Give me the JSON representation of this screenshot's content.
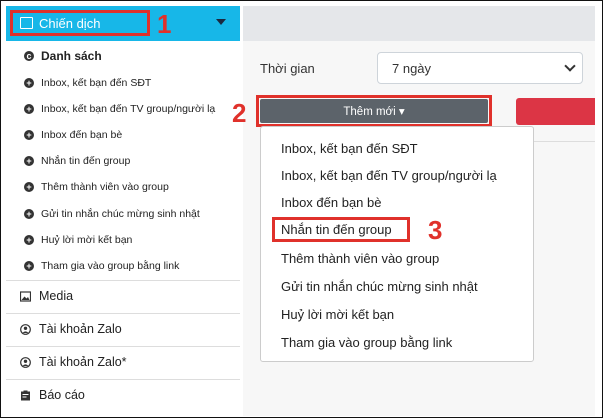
{
  "sidebar": {
    "campaign_label": "Chiến dịch",
    "items": [
      {
        "label": "Danh sách",
        "icon": "list-dot-icon"
      },
      {
        "label": "Inbox, kết bạn đến SĐT",
        "icon": "plus-dot-icon"
      },
      {
        "label": "Inbox, kết bạn đến TV group/người lạ",
        "icon": "plus-dot-icon"
      },
      {
        "label": "Inbox đến bạn bè",
        "icon": "plus-dot-icon"
      },
      {
        "label": "Nhắn tin đến group",
        "icon": "plus-dot-icon"
      },
      {
        "label": "Thêm thành viên vào group",
        "icon": "plus-dot-icon"
      },
      {
        "label": "Gửi tin nhắn chúc mừng sinh nhật",
        "icon": "plus-dot-icon"
      },
      {
        "label": "Huỷ lời mời kết bạn",
        "icon": "plus-dot-icon"
      },
      {
        "label": "Tham gia vào group bằng link",
        "icon": "plus-dot-icon"
      }
    ],
    "main_items": [
      {
        "label": "Media",
        "icon": "image-icon"
      },
      {
        "label": "Tài khoản Zalo",
        "icon": "user-circle-icon"
      },
      {
        "label": "Tài khoản Zalo*",
        "icon": "user-circle-icon"
      },
      {
        "label": "Báo cáo",
        "icon": "report-icon"
      }
    ]
  },
  "annotations": {
    "n1": "1",
    "n2": "2",
    "n3": "3"
  },
  "filter": {
    "label": "Thời gian",
    "value": "7 ngày"
  },
  "add_button": {
    "label": "Thêm mới ▾"
  },
  "dropdown": {
    "items": [
      "Inbox, kết bạn đến SĐT",
      "Inbox, kết bạn đến TV group/người lạ",
      "Inbox đến bạn bè",
      "Nhắn tin đến group",
      "Thêm thành viên vào group",
      "Gửi tin nhắn chúc mừng sinh nhật",
      "Huỷ lời mời kết bạn",
      "Tham gia vào group bằng link"
    ]
  },
  "colors": {
    "accent": "#17b7e8",
    "annotation_red": "#e0312b",
    "button_gray": "#5c636a",
    "danger": "#dc3545"
  }
}
